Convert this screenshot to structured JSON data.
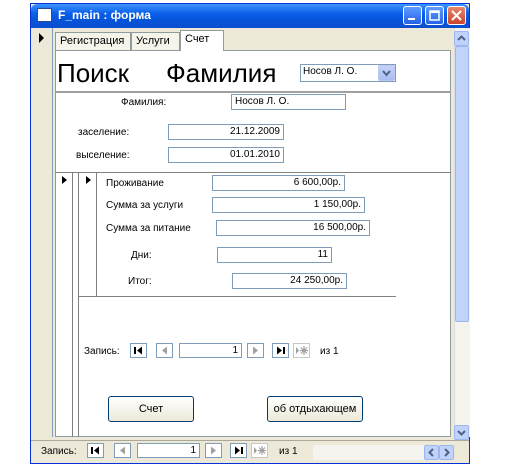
{
  "window": {
    "title": "F_main : форма",
    "controls": [
      "minimize-icon",
      "maximize-icon",
      "close-icon"
    ],
    "accent_color": "#0a5ee8"
  },
  "tabs": [
    {
      "label": "Регистрация",
      "active": false
    },
    {
      "label": "Услуги",
      "active": false
    },
    {
      "label": "Счет",
      "active": true
    }
  ],
  "header": {
    "search_label": "Поиск",
    "surname_label": "Фамилия",
    "surname_combo_value": "Носов Л. О."
  },
  "main": {
    "surname_field_label": "Фамилия:",
    "surname_field_value": "Носов Л. О.",
    "checkin_label": "заселение:",
    "checkin_value": "21.12.2009",
    "checkout_label": "выселение:",
    "checkout_value": "01.01.2010"
  },
  "subform": {
    "lodging_label": "Проживание",
    "lodging_value": "6 600,00р.",
    "services_label": "Сумма за услуги",
    "services_value": "1 150,00р.",
    "food_label": "Сумма за питание",
    "food_value": "16 500,00р.",
    "days_label": "Дни:",
    "days_value": "11",
    "total_label": "Итог:",
    "total_value": "24 250,00р.",
    "nav": {
      "record_label": "Запись:",
      "current": "1",
      "of_text": "из 1"
    }
  },
  "buttons": {
    "bill_label": "Счет",
    "guest_label": "об отдыхающем"
  },
  "bottom_nav": {
    "record_label": "Запись:",
    "current": "1",
    "of_text": "из 1"
  }
}
